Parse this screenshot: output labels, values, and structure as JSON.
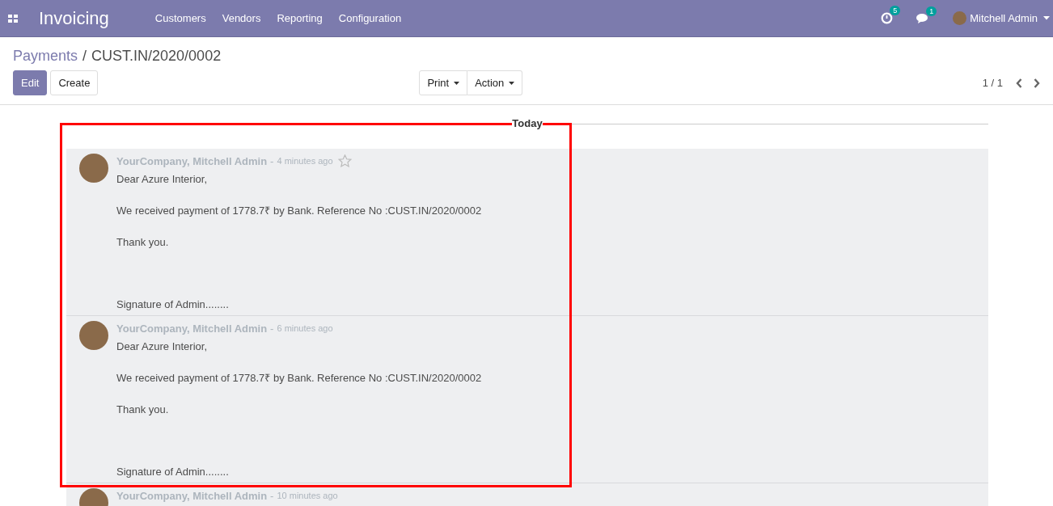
{
  "navbar": {
    "app_title": "Invoicing",
    "menu": [
      "Customers",
      "Vendors",
      "Reporting",
      "Configuration"
    ],
    "activity_badge": "5",
    "message_badge": "1",
    "user": "Mitchell Admin"
  },
  "breadcrumb": {
    "parent": "Payments",
    "separator": "/",
    "current": "CUST.IN/2020/0002"
  },
  "buttons": {
    "primary": [
      "Edit",
      "Create"
    ],
    "dropdowns": [
      "Print",
      "Action"
    ]
  },
  "pager": {
    "value": "1 / 1"
  },
  "chatter": {
    "date_divider": "Today",
    "messages": [
      {
        "author": "YourCompany, Mitchell Admin",
        "separator": "-",
        "time": "4 minutes ago",
        "star_icon": true,
        "body": [
          {
            "kind": "p",
            "text": "Dear Azure Interior,"
          },
          {
            "kind": "p",
            "text": "We received payment of 1778.7₹ by Bank. Reference No :CUST.IN/2020/0002"
          },
          {
            "kind": "p",
            "text": "Thank you."
          },
          {
            "kind": "signature",
            "text": "Signature of Admin........"
          }
        ]
      },
      {
        "author": "YourCompany, Mitchell Admin",
        "separator": "-",
        "time": "6 minutes ago",
        "star_icon": false,
        "body": [
          {
            "kind": "p",
            "text": "Dear Azure Interior,"
          },
          {
            "kind": "p",
            "text": "We received payment of 1778.7₹ by Bank. Reference No :CUST.IN/2020/0002"
          },
          {
            "kind": "p",
            "text": "Thank you."
          },
          {
            "kind": "signature",
            "text": "Signature of Admin........"
          }
        ]
      },
      {
        "author": "YourCompany, Mitchell Admin",
        "separator": "-",
        "time": "10 minutes ago",
        "star_icon": false
      }
    ]
  },
  "annotation_frame": true
}
